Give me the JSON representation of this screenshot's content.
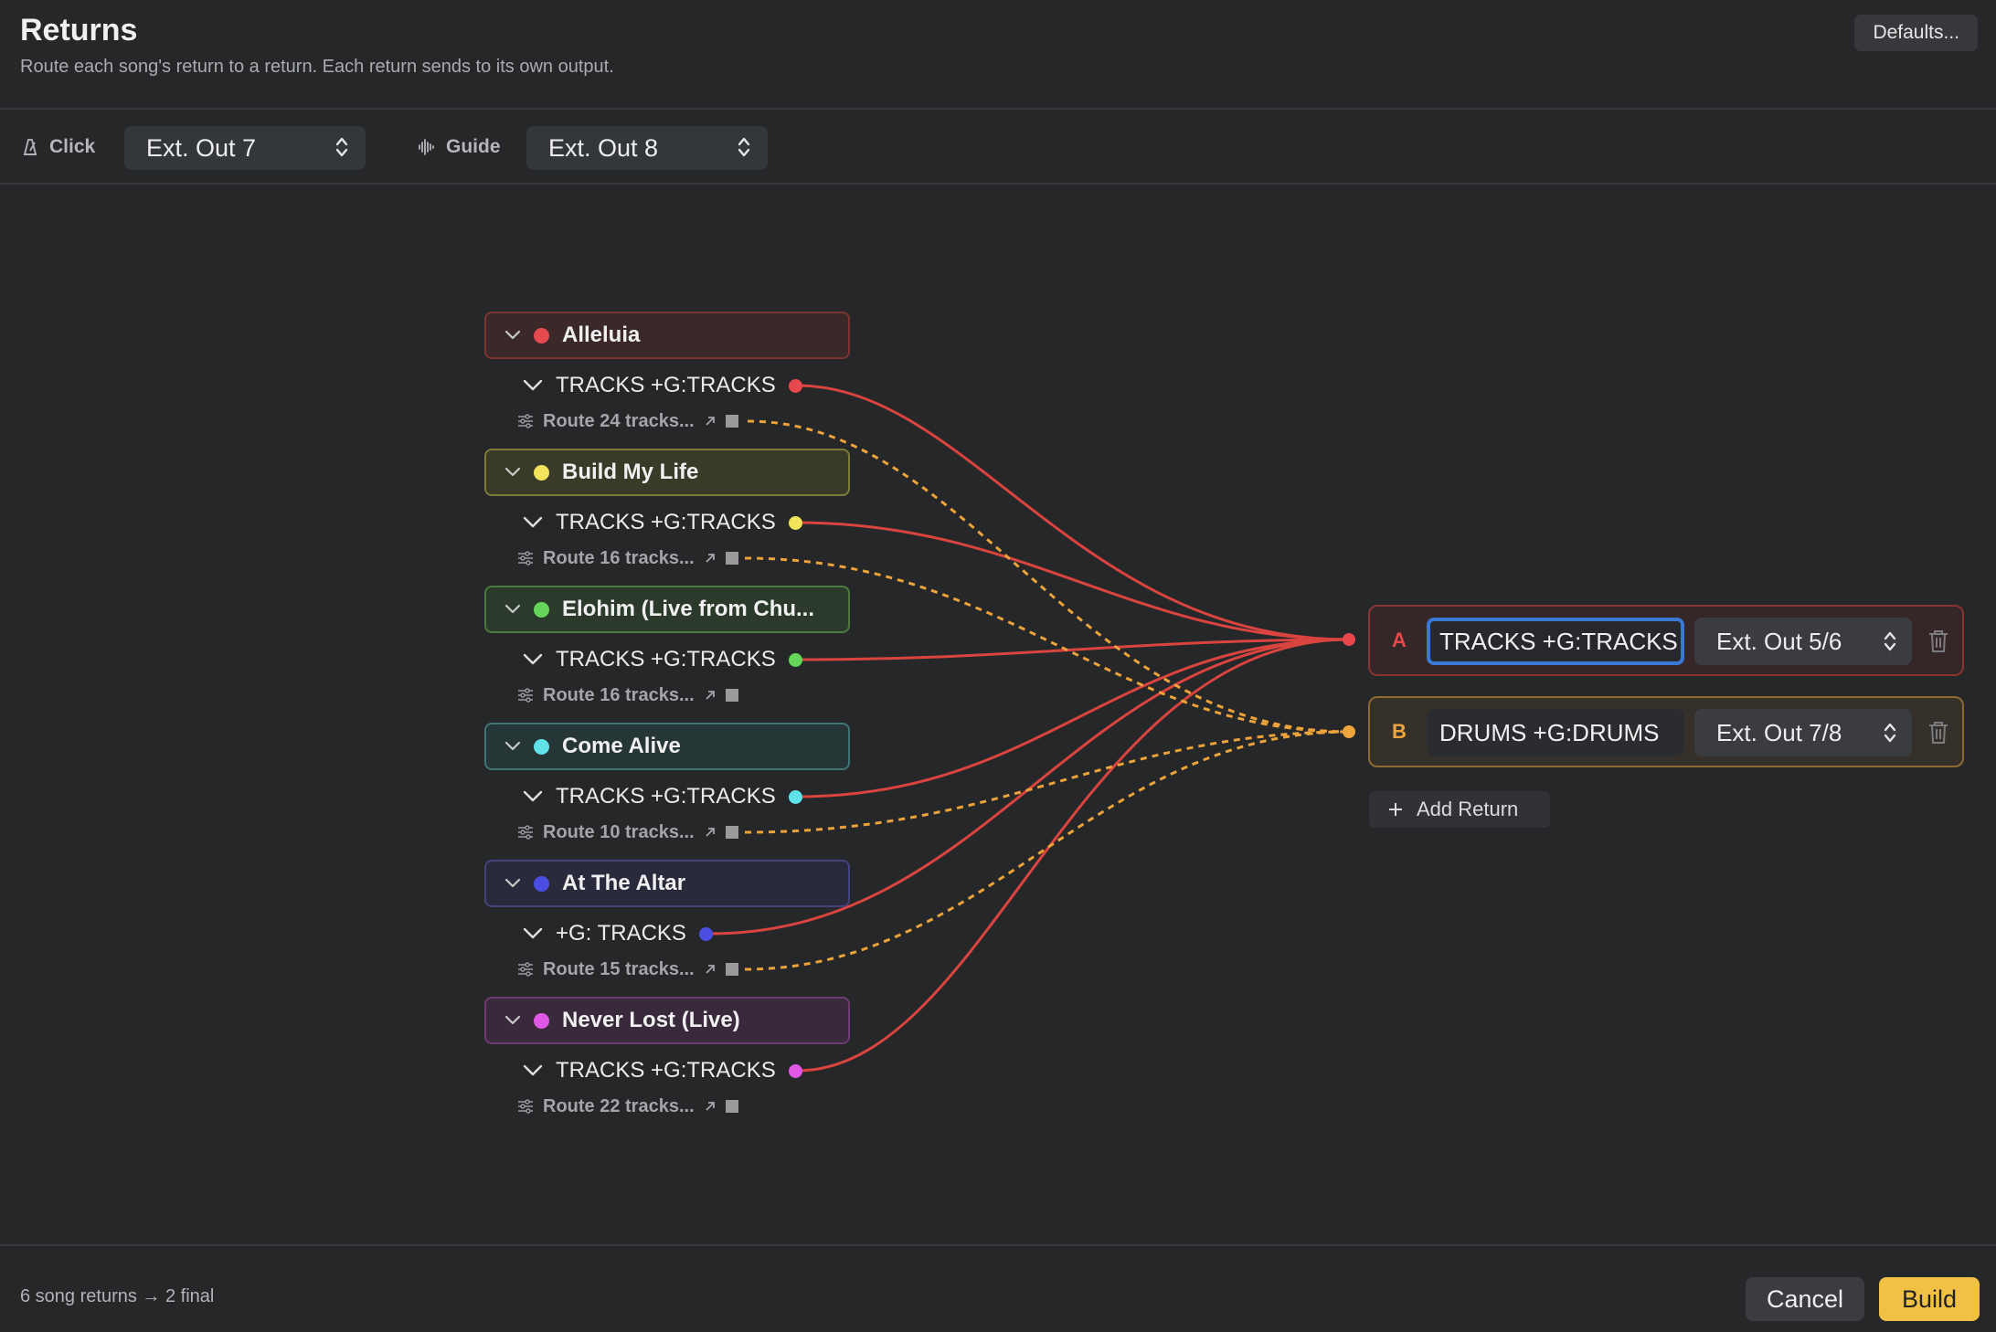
{
  "header": {
    "title": "Returns",
    "subtitle": "Route each song's return to a return. Each return sends to its own output.",
    "defaults_button": "Defaults..."
  },
  "toolbar": {
    "click": {
      "label": "Click",
      "icon": "metronome-icon",
      "value": "Ext. Out 7"
    },
    "guide": {
      "label": "Guide",
      "icon": "waveform-icon",
      "value": "Ext. Out 8"
    }
  },
  "songs": [
    {
      "name": "Alleluia",
      "color": "#e5484d",
      "return_label": "TRACKS +G:TRACKS",
      "route_label": "Route 24 tracks..."
    },
    {
      "name": "Build My Life",
      "color": "#f2e45a",
      "return_label": "TRACKS +G:TRACKS",
      "route_label": "Route 16 tracks..."
    },
    {
      "name": "Elohim (Live from Chu...",
      "color": "#66d65a",
      "return_label": "TRACKS +G:TRACKS",
      "route_label": "Route 16 tracks..."
    },
    {
      "name": "Come Alive",
      "color": "#5fe3e8",
      "return_label": "TRACKS +G:TRACKS",
      "route_label": "Route 10 tracks..."
    },
    {
      "name": "At The Altar",
      "color": "#4a4ee3",
      "return_label": "+G: TRACKS",
      "route_label": "Route 15 tracks..."
    },
    {
      "name": "Never Lost (Live)",
      "color": "#e059e6",
      "return_label": "TRACKS +G:TRACKS",
      "route_label": "Route 22 tracks..."
    }
  ],
  "final_returns": [
    {
      "letter": "A",
      "name": "TRACKS +G:TRACKS",
      "output": "Ext. Out 5/6",
      "color": "#e5484d"
    },
    {
      "letter": "B",
      "name": "DRUMS +G:DRUMS",
      "output": "Ext. Out 7/8",
      "color": "#f0a43c"
    }
  ],
  "add_return_label": "Add Return",
  "footer": {
    "summary": "6 song returns → 2 final",
    "cancel": "Cancel",
    "build": "Build"
  }
}
